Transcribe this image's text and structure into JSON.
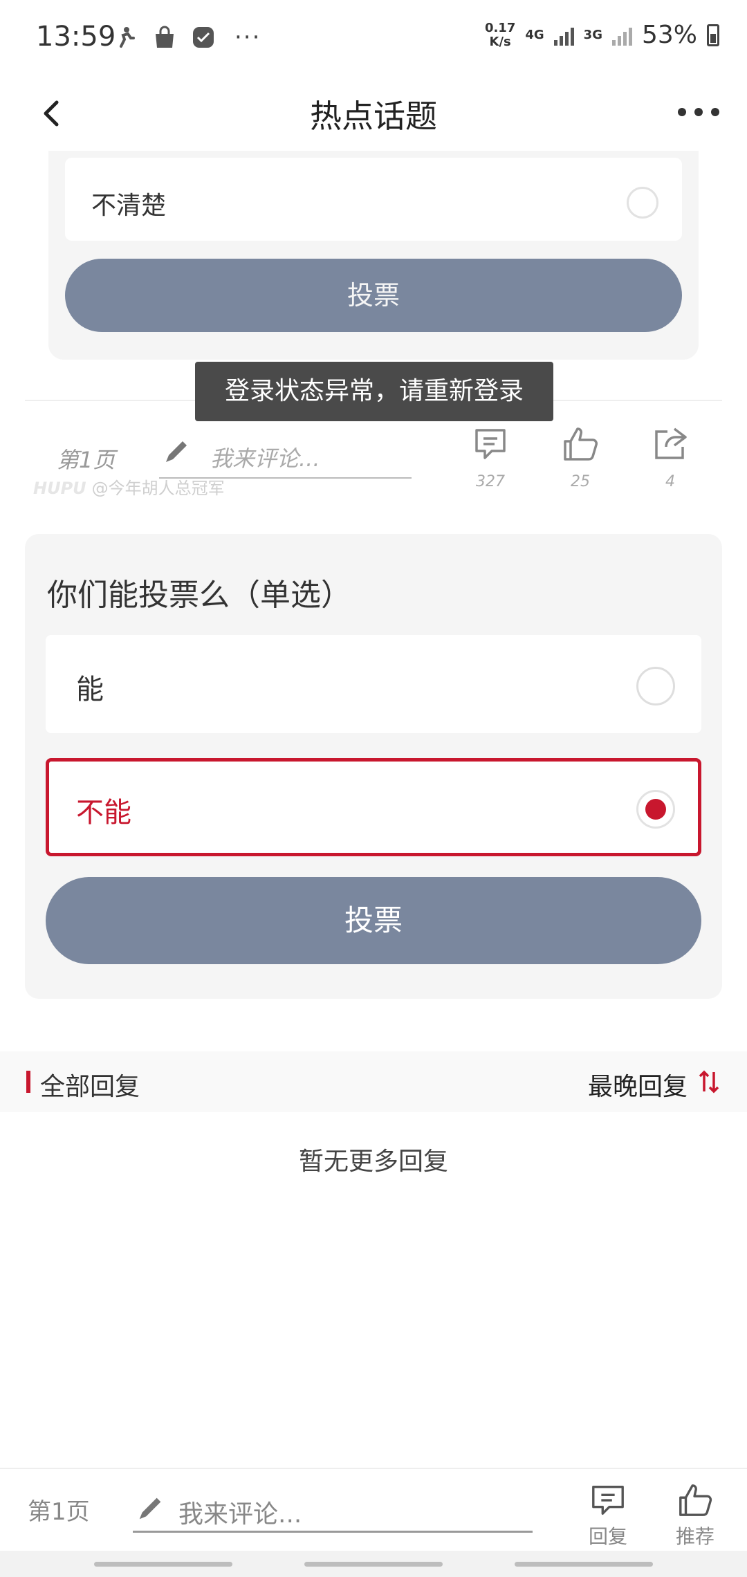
{
  "status_bar": {
    "time": "13:59",
    "net_speed_value": "0.17",
    "net_speed_unit": "K/s",
    "net_4g": "4G",
    "net_3g": "3G",
    "battery": "53%",
    "left_icons": [
      "run-icon",
      "shopping-bag-icon",
      "app-check-icon"
    ],
    "overflow": "···"
  },
  "nav": {
    "title": "热点话题",
    "back_icon": "chevron-left-icon",
    "more_icon": "more-dots-icon"
  },
  "post_image": {
    "option_top": "不清楚",
    "vote_label": "投票",
    "toast": "登录状态异常，请重新登录",
    "page_label": "第1页",
    "comment_placeholder": "我来评论...",
    "watermark_brand": "HUPU",
    "watermark_user": "@今年胡人总冠军",
    "comment_count": "327",
    "like_count": "25",
    "share_count": "4"
  },
  "poll": {
    "question": "你们能投票么（单选）",
    "options": [
      {
        "label": "能",
        "selected": false
      },
      {
        "label": "不能",
        "selected": true
      }
    ],
    "vote_label": "投票"
  },
  "replies": {
    "title": "全部回复",
    "sort_label": "最晚回复",
    "empty_text": "暂无更多回复"
  },
  "bottom_bar": {
    "page_label": "第1页",
    "comment_placeholder": "我来评论...",
    "reply_label": "回复",
    "recommend_label": "推荐"
  },
  "colors": {
    "accent": "#c8172e",
    "vote_button": "#7a879e",
    "card_bg": "#f5f5f5"
  }
}
